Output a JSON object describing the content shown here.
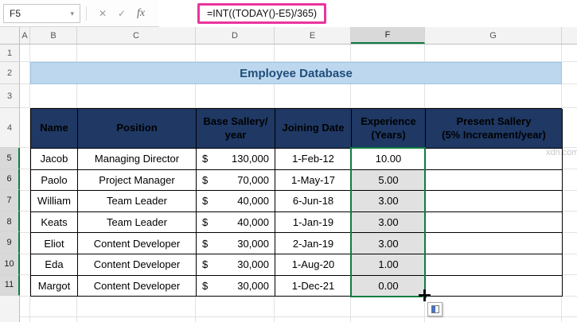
{
  "formula_bar": {
    "name_box": "F5",
    "cancel_glyph": "✕",
    "enter_glyph": "✓",
    "fx_label": "fx",
    "formula": "=INT((TODAY()-E5)/365)"
  },
  "column_headers": [
    "A",
    "B",
    "C",
    "D",
    "E",
    "F",
    "G"
  ],
  "row_headers": [
    "1",
    "2",
    "3",
    "4",
    "5",
    "6",
    "7",
    "8",
    "9",
    "10",
    "11"
  ],
  "title": "Employee Database",
  "table": {
    "headers": {
      "name": "Name",
      "position": "Position",
      "base_salary": "Base Sallery/\nyear",
      "joining_date": "Joining Date",
      "experience": "Experience\n(Years)",
      "present_salary": "Present Sallery\n(5% Increament/year)"
    },
    "currency_symbol": "$",
    "rows": [
      {
        "name": "Jacob",
        "position": "Managing Director",
        "base_salary": "130,000",
        "joining_date": "1-Feb-12",
        "experience": "10.00"
      },
      {
        "name": "Paolo",
        "position": "Project Manager",
        "base_salary": "70,000",
        "joining_date": "1-May-17",
        "experience": "5.00"
      },
      {
        "name": "William",
        "position": "Team Leader",
        "base_salary": "40,000",
        "joining_date": "6-Jun-18",
        "experience": "3.00"
      },
      {
        "name": "Keats",
        "position": "Team Leader",
        "base_salary": "40,000",
        "joining_date": "1-Jan-19",
        "experience": "3.00"
      },
      {
        "name": "Eliot",
        "position": "Content Developer",
        "base_salary": "30,000",
        "joining_date": "2-Jan-19",
        "experience": "3.00"
      },
      {
        "name": "Eda",
        "position": "Content Developer",
        "base_salary": "30,000",
        "joining_date": "1-Aug-20",
        "experience": "1.00"
      },
      {
        "name": "Margot",
        "position": "Content Developer",
        "base_salary": "30,000",
        "joining_date": "1-Dec-21",
        "experience": "0.00"
      }
    ]
  },
  "watermark": "xdn.com",
  "colors": {
    "table_header_bg": "#1F3864",
    "table_header_text": "#FFC000",
    "title_bg": "#BDD7EE",
    "title_text": "#1F4E79",
    "selection_green": "#107C41",
    "selection_fill": "#E1E1E1",
    "formula_highlight": "#E9349C"
  }
}
